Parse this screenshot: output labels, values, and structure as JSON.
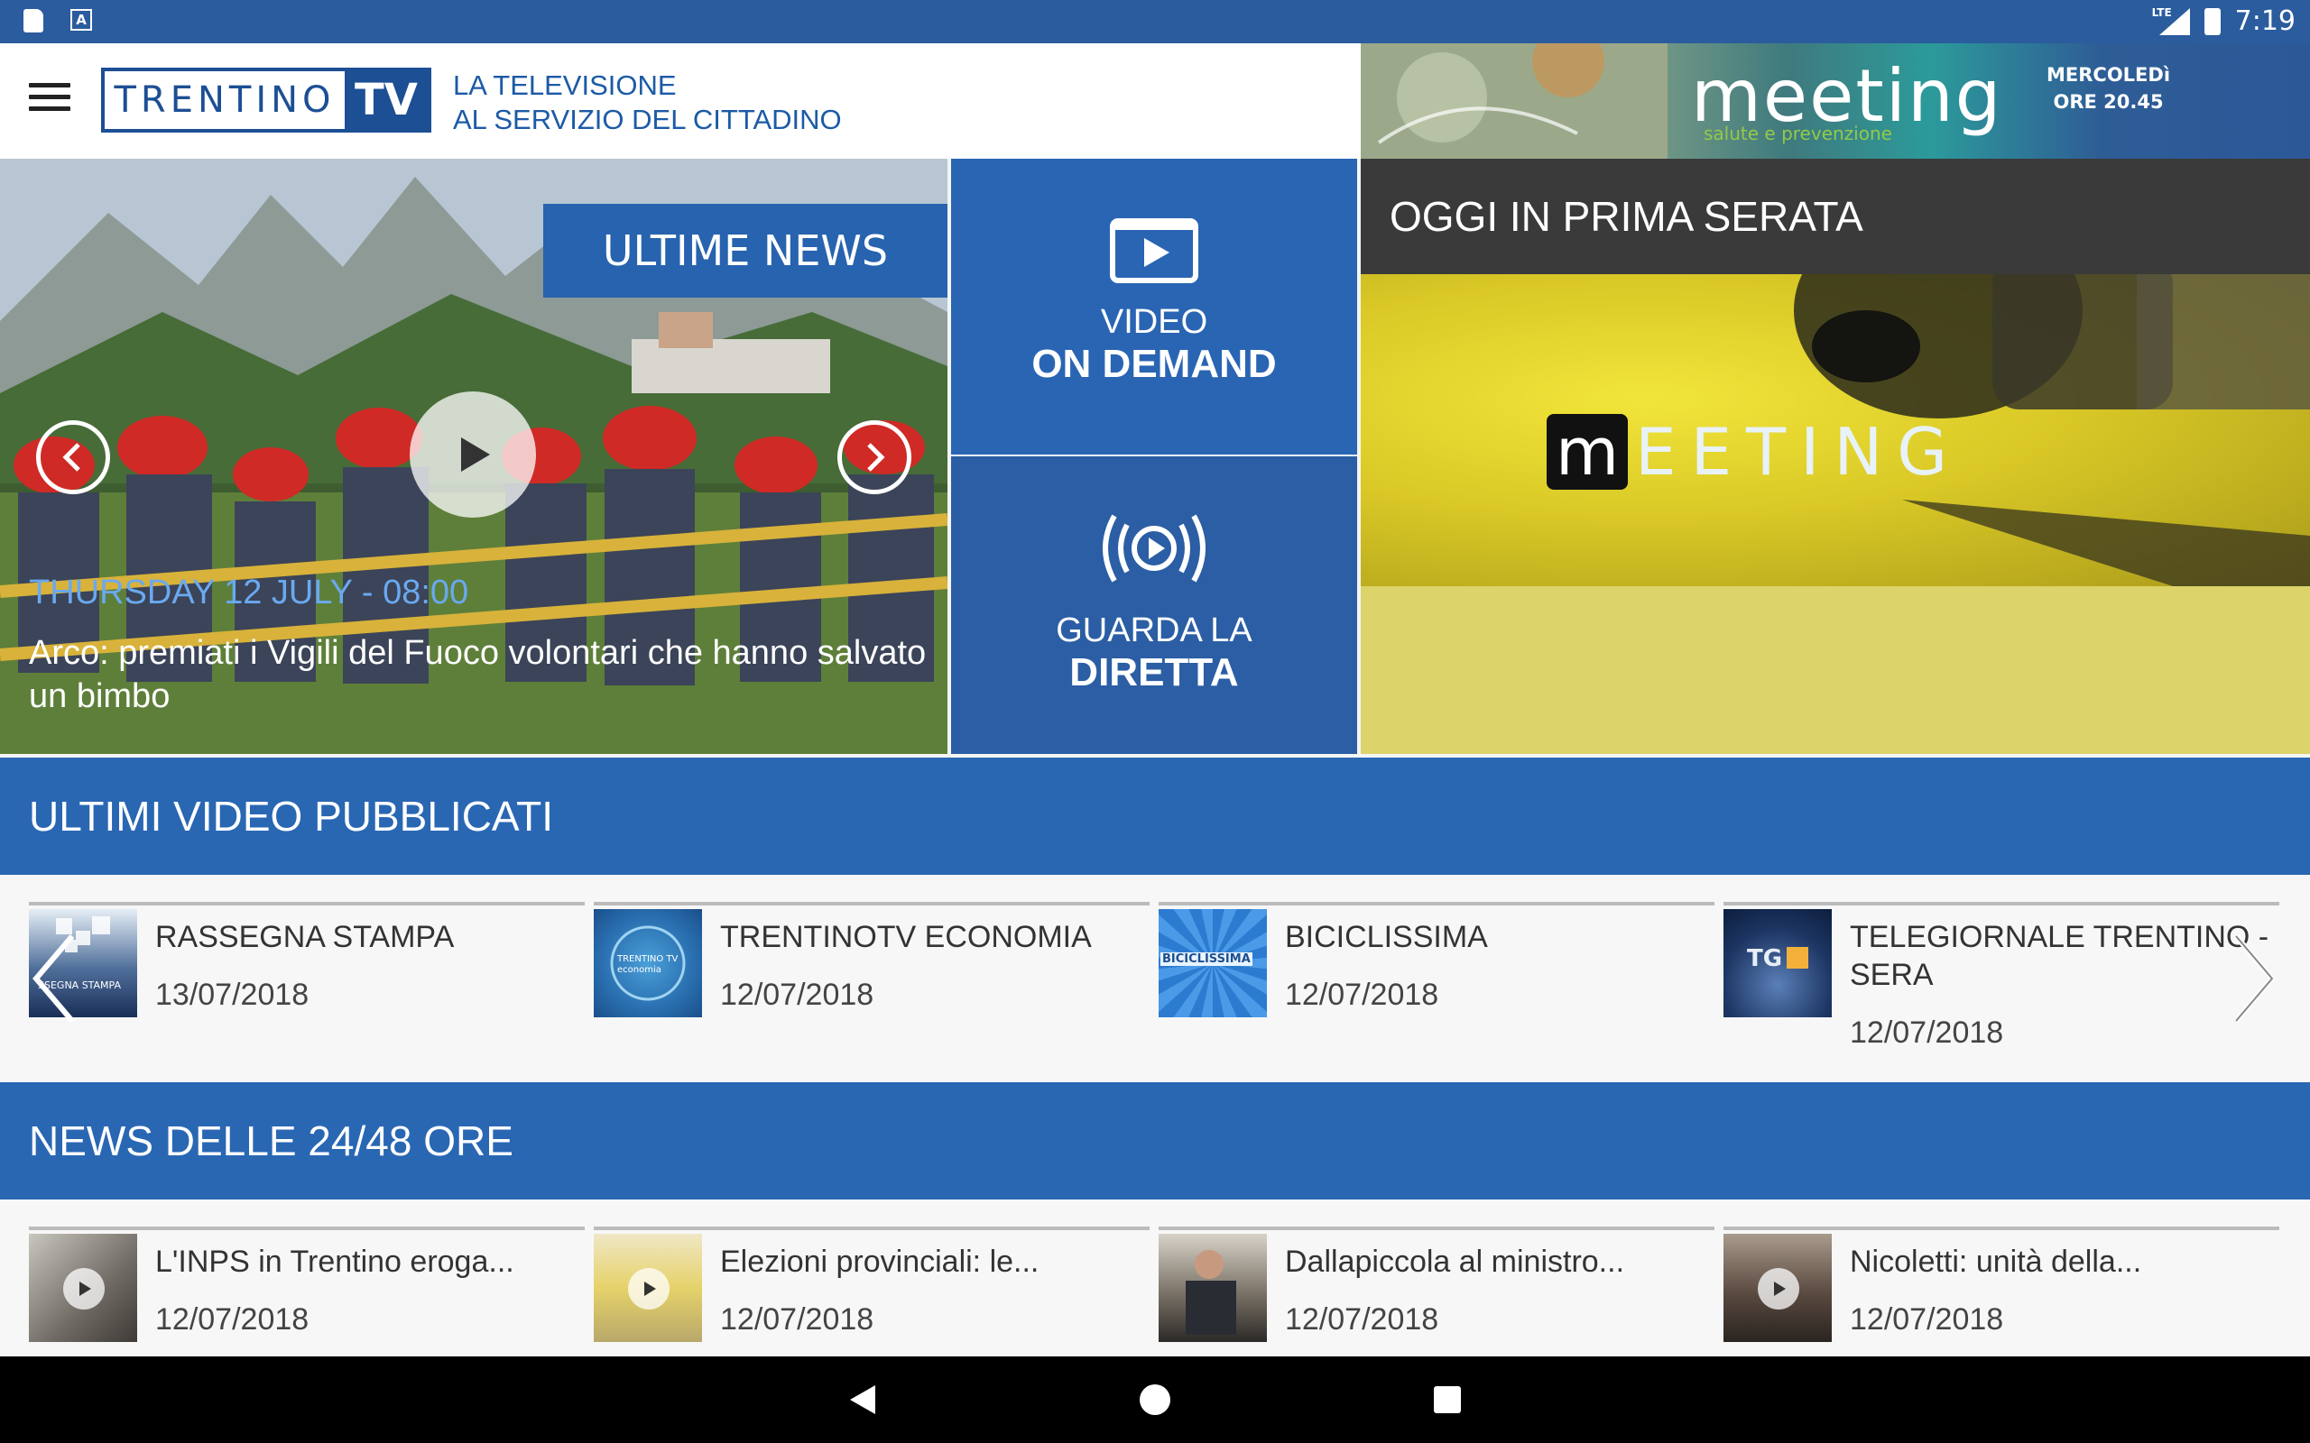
{
  "status_bar": {
    "network": "LTE",
    "time": "7:19"
  },
  "header": {
    "logo_left": "TRENTINO",
    "logo_right": "TV",
    "tagline_line1": "LA TELEVISIONE",
    "tagline_line2": "AL SERVIZIO DEL CITTADINO"
  },
  "banner": {
    "word": "meeting",
    "sub": "salute e prevenzione",
    "day": "MERCOLEDì",
    "time": "ORE 20.45"
  },
  "hero": {
    "tag": "ULTIME NEWS",
    "date": "THURSDAY 12 JULY - 08:00",
    "title": "Arco: premiati i Vigili del Fuoco volontari che hanno salvato un bimbo"
  },
  "tiles": {
    "vod_line1": "VIDEO",
    "vod_line2": "ON DEMAND",
    "live_line1": "GUARDA LA",
    "live_line2": "DIRETTA"
  },
  "prima_serata": {
    "heading": "OGGI IN PRIMA SERATA",
    "logo_m": "m",
    "logo_rest": "EETING"
  },
  "videos": {
    "heading": "ULTIMI VIDEO PUBBLICATI",
    "items": [
      {
        "title": "RASSEGNA STAMPA",
        "date": "13/07/2018",
        "thumb_text": "SSEGNA STAMPA"
      },
      {
        "title": "TRENTINOTV ECONOMIA",
        "date": "12/07/2018",
        "thumb_text": "TRENTINO TV economia"
      },
      {
        "title": "BICICLISSIMA",
        "date": "12/07/2018",
        "thumb_text": "BICICLISSIMA"
      },
      {
        "title": "TELEGIORNALE TRENTINO - SERA",
        "date": "12/07/2018",
        "thumb_text": "TG"
      }
    ]
  },
  "news": {
    "heading": "NEWS DELLE 24/48 ORE",
    "items": [
      {
        "title": "L'INPS in Trentino eroga...",
        "date": "12/07/2018"
      },
      {
        "title": "Elezioni provinciali: le...",
        "date": "12/07/2018"
      },
      {
        "title": "Dallapiccola al ministro...",
        "date": "12/07/2018"
      },
      {
        "title": "Nicoletti: unità della...",
        "date": "12/07/2018"
      }
    ]
  },
  "colors": {
    "brand_blue": "#2967b3",
    "status_bar": "#2a5c9e",
    "date_blue": "#6aa9f0"
  }
}
